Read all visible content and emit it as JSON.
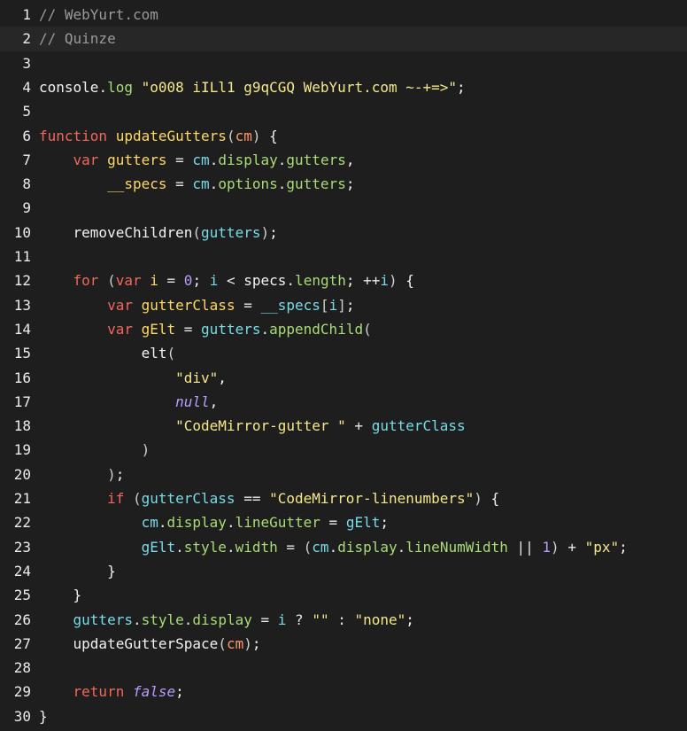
{
  "editor": {
    "active_line": 2,
    "lines": [
      {
        "number": "1",
        "tokens": [
          {
            "t": "// WebYurt.com",
            "k": "comment"
          }
        ]
      },
      {
        "number": "2",
        "tokens": [
          {
            "t": "// Quinze",
            "k": "comment"
          }
        ]
      },
      {
        "number": "3",
        "tokens": []
      },
      {
        "number": "4",
        "tokens": [
          {
            "t": "console",
            "k": "plain"
          },
          {
            "t": ".",
            "k": "operator"
          },
          {
            "t": "log",
            "k": "property"
          },
          {
            "t": " ",
            "k": "plain"
          },
          {
            "t": "\"o008 iILl1 g9qCGQ WebYurt.com ~-+=>\"",
            "k": "string"
          },
          {
            "t": ";",
            "k": "plain"
          }
        ]
      },
      {
        "number": "5",
        "tokens": []
      },
      {
        "number": "6",
        "tokens": [
          {
            "t": "function",
            "k": "keyword"
          },
          {
            "t": " ",
            "k": "plain"
          },
          {
            "t": "updateGutters",
            "k": "def"
          },
          {
            "t": "(",
            "k": "bracket"
          },
          {
            "t": "cm",
            "k": "variable-2"
          },
          {
            "t": ")",
            "k": "bracket"
          },
          {
            "t": " {",
            "k": "plain"
          }
        ]
      },
      {
        "number": "7",
        "tokens": [
          {
            "t": "    ",
            "k": "plain"
          },
          {
            "t": "var",
            "k": "keyword"
          },
          {
            "t": " ",
            "k": "plain"
          },
          {
            "t": "gutters",
            "k": "def"
          },
          {
            "t": " = ",
            "k": "operator"
          },
          {
            "t": "cm",
            "k": "variable"
          },
          {
            "t": ".",
            "k": "operator"
          },
          {
            "t": "display",
            "k": "property"
          },
          {
            "t": ".",
            "k": "operator"
          },
          {
            "t": "gutters",
            "k": "property"
          },
          {
            "t": ",",
            "k": "plain"
          }
        ]
      },
      {
        "number": "8",
        "tokens": [
          {
            "t": "        ",
            "k": "plain"
          },
          {
            "t": "__specs",
            "k": "def"
          },
          {
            "t": " = ",
            "k": "operator"
          },
          {
            "t": "cm",
            "k": "variable"
          },
          {
            "t": ".",
            "k": "operator"
          },
          {
            "t": "options",
            "k": "property"
          },
          {
            "t": ".",
            "k": "operator"
          },
          {
            "t": "gutters",
            "k": "property"
          },
          {
            "t": ";",
            "k": "plain"
          }
        ]
      },
      {
        "number": "9",
        "tokens": []
      },
      {
        "number": "10",
        "tokens": [
          {
            "t": "    ",
            "k": "plain"
          },
          {
            "t": "removeChildren",
            "k": "plain"
          },
          {
            "t": "(",
            "k": "bracket"
          },
          {
            "t": "gutters",
            "k": "variable"
          },
          {
            "t": ")",
            "k": "bracket"
          },
          {
            "t": ";",
            "k": "plain"
          }
        ]
      },
      {
        "number": "11",
        "tokens": []
      },
      {
        "number": "12",
        "tokens": [
          {
            "t": "    ",
            "k": "plain"
          },
          {
            "t": "for",
            "k": "keyword"
          },
          {
            "t": " (",
            "k": "bracket"
          },
          {
            "t": "var",
            "k": "keyword"
          },
          {
            "t": " ",
            "k": "plain"
          },
          {
            "t": "i",
            "k": "def"
          },
          {
            "t": " = ",
            "k": "operator"
          },
          {
            "t": "0",
            "k": "number"
          },
          {
            "t": "; ",
            "k": "plain"
          },
          {
            "t": "i",
            "k": "variable"
          },
          {
            "t": " < ",
            "k": "operator"
          },
          {
            "t": "specs",
            "k": "plain"
          },
          {
            "t": ".",
            "k": "operator"
          },
          {
            "t": "length",
            "k": "property"
          },
          {
            "t": "; ",
            "k": "plain"
          },
          {
            "t": "++",
            "k": "operator"
          },
          {
            "t": "i",
            "k": "variable"
          },
          {
            "t": ")",
            "k": "bracket"
          },
          {
            "t": " {",
            "k": "plain"
          }
        ]
      },
      {
        "number": "13",
        "tokens": [
          {
            "t": "        ",
            "k": "plain"
          },
          {
            "t": "var",
            "k": "keyword"
          },
          {
            "t": " ",
            "k": "plain"
          },
          {
            "t": "gutterClass",
            "k": "def"
          },
          {
            "t": " = ",
            "k": "operator"
          },
          {
            "t": "__specs",
            "k": "variable"
          },
          {
            "t": "[",
            "k": "bracket"
          },
          {
            "t": "i",
            "k": "variable"
          },
          {
            "t": "]",
            "k": "bracket"
          },
          {
            "t": ";",
            "k": "plain"
          }
        ]
      },
      {
        "number": "14",
        "tokens": [
          {
            "t": "        ",
            "k": "plain"
          },
          {
            "t": "var",
            "k": "keyword"
          },
          {
            "t": " ",
            "k": "plain"
          },
          {
            "t": "gElt",
            "k": "def"
          },
          {
            "t": " = ",
            "k": "operator"
          },
          {
            "t": "gutters",
            "k": "variable"
          },
          {
            "t": ".",
            "k": "operator"
          },
          {
            "t": "appendChild",
            "k": "property"
          },
          {
            "t": "(",
            "k": "bracket"
          }
        ]
      },
      {
        "number": "15",
        "tokens": [
          {
            "t": "            ",
            "k": "plain"
          },
          {
            "t": "elt",
            "k": "plain"
          },
          {
            "t": "(",
            "k": "bracket"
          }
        ]
      },
      {
        "number": "16",
        "tokens": [
          {
            "t": "                ",
            "k": "plain"
          },
          {
            "t": "\"div\"",
            "k": "string"
          },
          {
            "t": ",",
            "k": "plain"
          }
        ]
      },
      {
        "number": "17",
        "tokens": [
          {
            "t": "                ",
            "k": "plain"
          },
          {
            "t": "null",
            "k": "atom"
          },
          {
            "t": ",",
            "k": "plain"
          }
        ]
      },
      {
        "number": "18",
        "tokens": [
          {
            "t": "                ",
            "k": "plain"
          },
          {
            "t": "\"CodeMirror-gutter \"",
            "k": "string"
          },
          {
            "t": " + ",
            "k": "operator"
          },
          {
            "t": "gutterClass",
            "k": "variable"
          }
        ]
      },
      {
        "number": "19",
        "tokens": [
          {
            "t": "            ",
            "k": "plain"
          },
          {
            "t": ")",
            "k": "bracket"
          }
        ]
      },
      {
        "number": "20",
        "tokens": [
          {
            "t": "        ",
            "k": "plain"
          },
          {
            "t": ")",
            "k": "bracket"
          },
          {
            "t": ";",
            "k": "plain"
          }
        ]
      },
      {
        "number": "21",
        "tokens": [
          {
            "t": "        ",
            "k": "plain"
          },
          {
            "t": "if",
            "k": "keyword"
          },
          {
            "t": " (",
            "k": "bracket"
          },
          {
            "t": "gutterClass",
            "k": "variable"
          },
          {
            "t": " == ",
            "k": "operator"
          },
          {
            "t": "\"CodeMirror-linenumbers\"",
            "k": "string"
          },
          {
            "t": ")",
            "k": "bracket"
          },
          {
            "t": " {",
            "k": "plain"
          }
        ]
      },
      {
        "number": "22",
        "tokens": [
          {
            "t": "            ",
            "k": "plain"
          },
          {
            "t": "cm",
            "k": "variable"
          },
          {
            "t": ".",
            "k": "operator"
          },
          {
            "t": "display",
            "k": "property"
          },
          {
            "t": ".",
            "k": "operator"
          },
          {
            "t": "lineGutter",
            "k": "property"
          },
          {
            "t": " = ",
            "k": "operator"
          },
          {
            "t": "gElt",
            "k": "variable"
          },
          {
            "t": ";",
            "k": "plain"
          }
        ]
      },
      {
        "number": "23",
        "tokens": [
          {
            "t": "            ",
            "k": "plain"
          },
          {
            "t": "gElt",
            "k": "variable"
          },
          {
            "t": ".",
            "k": "operator"
          },
          {
            "t": "style",
            "k": "property"
          },
          {
            "t": ".",
            "k": "operator"
          },
          {
            "t": "width",
            "k": "property"
          },
          {
            "t": " = ",
            "k": "operator"
          },
          {
            "t": "(",
            "k": "bracket"
          },
          {
            "t": "cm",
            "k": "variable"
          },
          {
            "t": ".",
            "k": "operator"
          },
          {
            "t": "display",
            "k": "property"
          },
          {
            "t": ".",
            "k": "operator"
          },
          {
            "t": "lineNumWidth",
            "k": "property"
          },
          {
            "t": " || ",
            "k": "operator"
          },
          {
            "t": "1",
            "k": "number"
          },
          {
            "t": ")",
            "k": "bracket"
          },
          {
            "t": " + ",
            "k": "operator"
          },
          {
            "t": "\"px\"",
            "k": "string"
          },
          {
            "t": ";",
            "k": "plain"
          }
        ]
      },
      {
        "number": "24",
        "tokens": [
          {
            "t": "        ",
            "k": "plain"
          },
          {
            "t": "}",
            "k": "plain"
          }
        ]
      },
      {
        "number": "25",
        "tokens": [
          {
            "t": "    ",
            "k": "plain"
          },
          {
            "t": "}",
            "k": "plain"
          }
        ]
      },
      {
        "number": "26",
        "tokens": [
          {
            "t": "    ",
            "k": "plain"
          },
          {
            "t": "gutters",
            "k": "variable"
          },
          {
            "t": ".",
            "k": "operator"
          },
          {
            "t": "style",
            "k": "property"
          },
          {
            "t": ".",
            "k": "operator"
          },
          {
            "t": "display",
            "k": "property"
          },
          {
            "t": " = ",
            "k": "operator"
          },
          {
            "t": "i",
            "k": "variable"
          },
          {
            "t": " ? ",
            "k": "operator"
          },
          {
            "t": "\"\"",
            "k": "string"
          },
          {
            "t": " : ",
            "k": "operator"
          },
          {
            "t": "\"none\"",
            "k": "string"
          },
          {
            "t": ";",
            "k": "plain"
          }
        ]
      },
      {
        "number": "27",
        "tokens": [
          {
            "t": "    ",
            "k": "plain"
          },
          {
            "t": "updateGutterSpace",
            "k": "plain"
          },
          {
            "t": "(",
            "k": "bracket"
          },
          {
            "t": "cm",
            "k": "variable-2"
          },
          {
            "t": ")",
            "k": "bracket"
          },
          {
            "t": ";",
            "k": "plain"
          }
        ]
      },
      {
        "number": "28",
        "tokens": []
      },
      {
        "number": "29",
        "tokens": [
          {
            "t": "    ",
            "k": "plain"
          },
          {
            "t": "return",
            "k": "keyword"
          },
          {
            "t": " ",
            "k": "plain"
          },
          {
            "t": "false",
            "k": "atom"
          },
          {
            "t": ";",
            "k": "plain"
          }
        ]
      },
      {
        "number": "30",
        "tokens": [
          {
            "t": "}",
            "k": "plain"
          }
        ]
      }
    ]
  }
}
